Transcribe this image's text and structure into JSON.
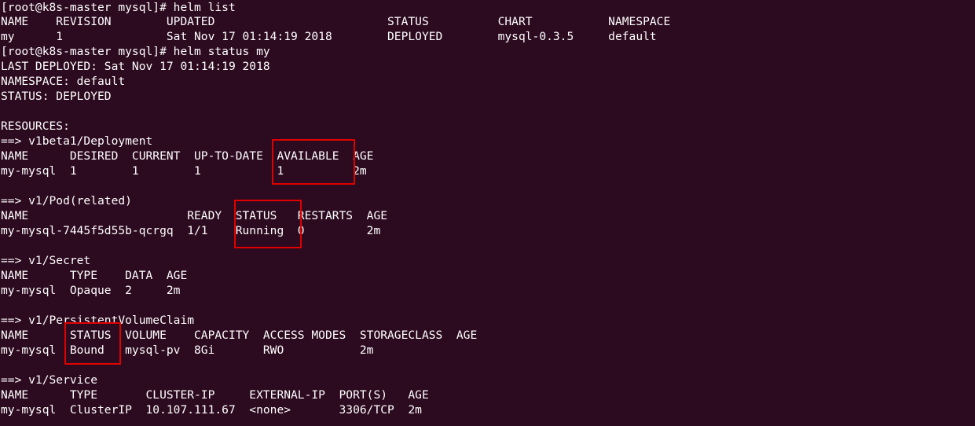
{
  "terminal": {
    "background": "#2c0a1f",
    "text_color": "#ffffff",
    "highlight_color": "#e00000",
    "lines": [
      "[root@k8s-master mysql]# helm list",
      "NAME    REVISION        UPDATED                         STATUS          CHART           NAMESPACE",
      "my      1               Sat Nov 17 01:14:19 2018        DEPLOYED        mysql-0.3.5     default",
      "[root@k8s-master mysql]# helm status my",
      "LAST DEPLOYED: Sat Nov 17 01:14:19 2018",
      "NAMESPACE: default",
      "STATUS: DEPLOYED",
      "",
      "RESOURCES:",
      "==> v1beta1/Deployment",
      "NAME      DESIRED  CURRENT  UP-TO-DATE  AVAILABLE  AGE",
      "my-mysql  1        1        1           1          2m",
      "",
      "==> v1/Pod(related)",
      "NAME                       READY  STATUS   RESTARTS  AGE",
      "my-mysql-7445f5d55b-qcrgq  1/1    Running  0         2m",
      "",
      "==> v1/Secret",
      "NAME      TYPE    DATA  AGE",
      "my-mysql  Opaque  2     2m",
      "",
      "==> v1/PersistentVolumeClaim",
      "NAME      STATUS  VOLUME    CAPACITY  ACCESS MODES  STORAGECLASS  AGE",
      "my-mysql  Bound   mysql-pv  8Gi       RWO           2m",
      "",
      "==> v1/Service",
      "NAME      TYPE       CLUSTER-IP     EXTERNAL-IP  PORT(S)   AGE",
      "my-mysql  ClusterIP  10.107.111.67  <none>       3306/TCP  2m"
    ]
  }
}
